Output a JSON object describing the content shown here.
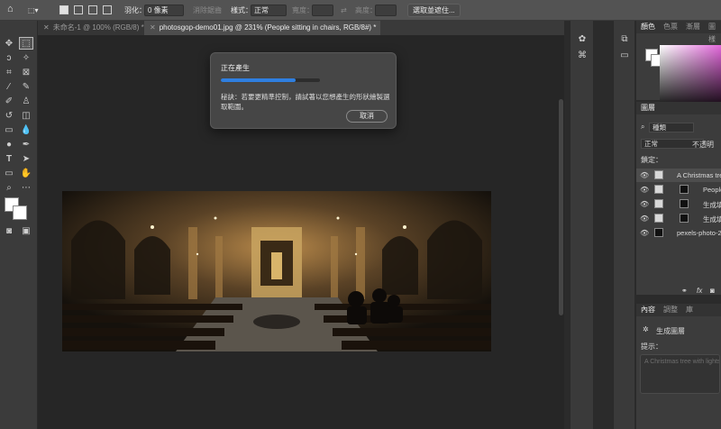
{
  "options_bar": {
    "feather_label": "羽化：",
    "feather_value": "0 像素",
    "antialias_label": "消除鋸齒",
    "style_label": "樣式：",
    "style_value": "正常",
    "width_label": "寬度：",
    "height_label": "高度：",
    "select_subject_button": "選取並遮住..."
  },
  "tabs": [
    {
      "label": "未命名-1 @ 100% (RGB/8) *",
      "active": false
    },
    {
      "label": "photosgop-demo01.jpg @ 231% (People sitting in chairs, RGB/8#) *",
      "active": true
    }
  ],
  "dialog": {
    "title": "正在產生",
    "progress": 0.75,
    "hint": "秘訣：若要更精準控制，請試著以您想產生的形狀繪製選取範圍。",
    "cancel_button": "取消"
  },
  "color_panel": {
    "tabs": [
      "顏色",
      "色票",
      "漸層",
      "圖樣"
    ],
    "hue_color": "#e05bd8"
  },
  "layers_panel": {
    "tab": "圖層",
    "filter_label": "種類",
    "blend_mode": "正常",
    "opacity_label": "不透明",
    "lock_label": "鎖定：",
    "layers": [
      {
        "name": "A Christmas tre",
        "selected": true
      },
      {
        "name": "People",
        "selected": false
      },
      {
        "name": "生成填",
        "selected": false
      },
      {
        "name": "生成填",
        "selected": false
      },
      {
        "name": "pexels-photo-2",
        "selected": false
      }
    ]
  },
  "properties_panel": {
    "tabs": [
      "內容",
      "調整",
      "庫"
    ],
    "section_title": "生成圖層",
    "prompt_label": "提示：",
    "prompt_placeholder": "A Christmas tree with lights"
  },
  "colors": {
    "accent": "#2f7fe0",
    "panel_bg": "#3c3c3c",
    "canvas_bg": "#262626"
  }
}
